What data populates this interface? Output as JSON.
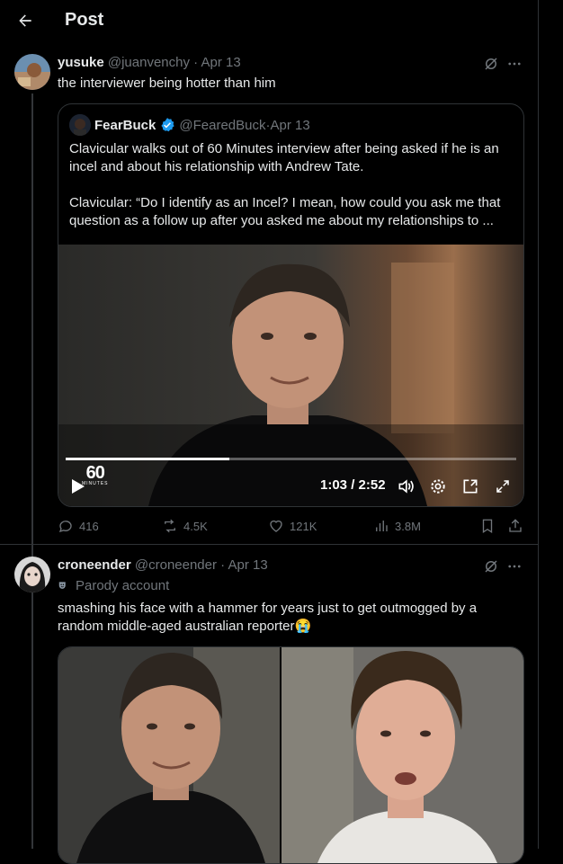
{
  "header": {
    "title": "Post"
  },
  "post": {
    "author_name": "yusuke",
    "author_handle": "@juanvenchy",
    "date": "Apr 13",
    "text": "the interviewer being hotter than him"
  },
  "quote": {
    "author_name": "FearBuck",
    "author_handle": "@FearedBuck",
    "date": "Apr 13",
    "paragraph_1": "Clavicular walks out of 60 Minutes interview after being asked if he is an incel and about his relationship with Andrew Tate.",
    "paragraph_2": "Clavicular: “Do I identify as an Incel? I mean, how could you ask me that question as a follow up after you asked me about my relationships to ...",
    "video": {
      "time": "1:03 / 2:52",
      "progress": 0.363,
      "watermark_top": "60",
      "watermark_bottom": "MINUTES"
    }
  },
  "actions": {
    "replies": "416",
    "reposts": "4.5K",
    "likes": "121K",
    "views": "3.8M"
  },
  "reply": {
    "author_name": "croneender",
    "author_handle": "@croneender",
    "date": "Apr 13",
    "label": "Parody account",
    "text": "smashing his face with a hammer for years just to get outmogged by a random middle-aged australian reporter",
    "emoji": "😭"
  },
  "colors": {
    "accent": "#1d9bf0",
    "muted": "#71767b",
    "border": "#2f3336"
  }
}
